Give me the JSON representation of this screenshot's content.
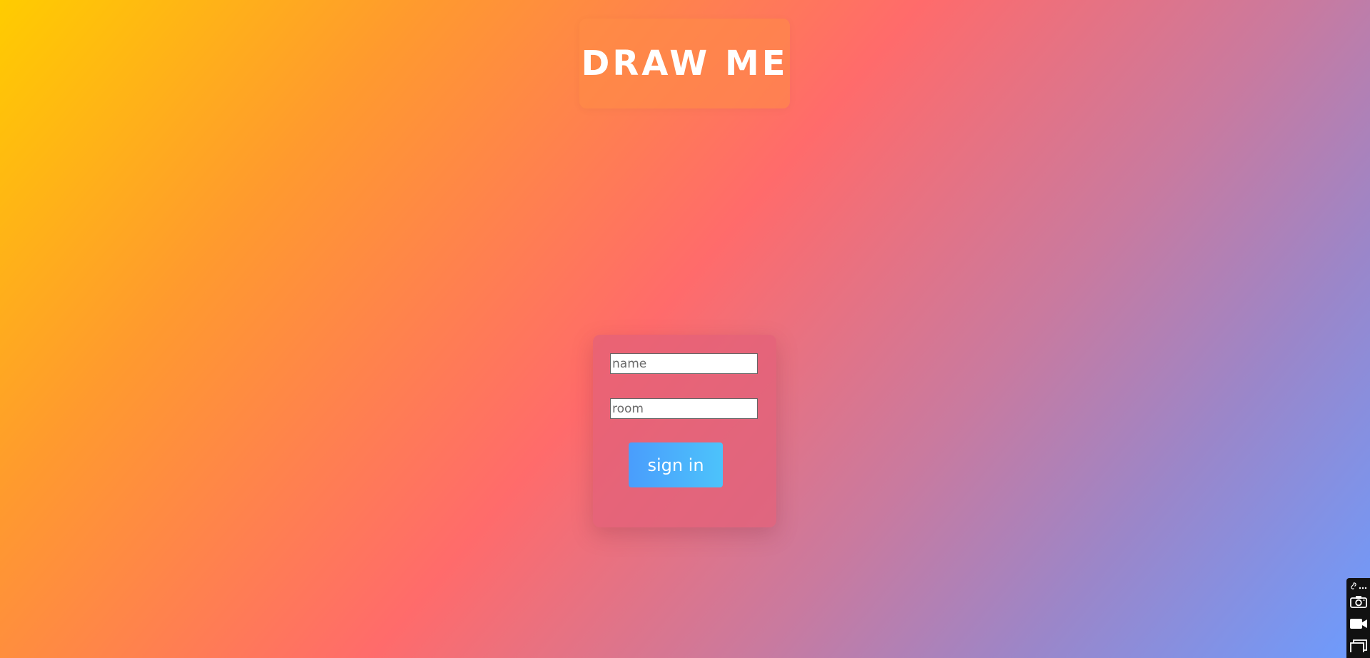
{
  "header": {
    "title": "DRAW ME"
  },
  "login": {
    "name_placeholder": "name",
    "name_value": "",
    "room_placeholder": "room",
    "room_value": "",
    "signin_label": "sign in"
  },
  "toolbar": {
    "icons": [
      "link-icon",
      "more-icon",
      "camera-icon",
      "video-icon",
      "window-icon"
    ]
  },
  "colors": {
    "gradient_start": "#ffcc00",
    "gradient_mid": "#ff6b6b",
    "gradient_end": "#6b9cff",
    "button_start": "#4a9dfc",
    "button_end": "#4cc3fb"
  }
}
